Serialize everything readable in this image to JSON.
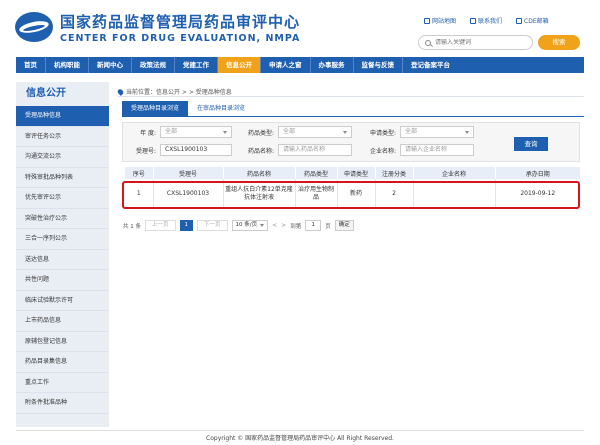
{
  "header": {
    "title_cn": "国家药品监督管理局药品审评中心",
    "title_en": "CENTER FOR DRUG EVALUATION, NMPA",
    "links": [
      "网站地图",
      "联系我们",
      "CDE邮箱"
    ],
    "search_placeholder": "请输入关键词",
    "search_button": "搜索"
  },
  "nav": {
    "items": [
      "首页",
      "机构职能",
      "新闻中心",
      "政策法规",
      "党建工作",
      "信息公开",
      "申请人之窗",
      "办事服务",
      "监督与反馈",
      "登记备案平台"
    ],
    "active": "信息公开"
  },
  "sidebar": {
    "title": "信息公开",
    "items": [
      "受理品种信息",
      "审评任务公示",
      "沟通交流公示",
      "特殊审批品种列表",
      "优先审评公示",
      "突破性治疗公示",
      "三合一序列公示",
      "送达信息",
      "共性问题",
      "临床试验默示许可",
      "上市药品信息",
      "原辅包登记信息",
      "药品目录集信息",
      "重点工作",
      "附条件批准品种"
    ],
    "active": "受理品种信息"
  },
  "breadcrumb": {
    "text": "当前位置：信息公开 > > 受理品种信息"
  },
  "tabs": [
    "受理品种目录浏览",
    "在审品种目录浏览"
  ],
  "filter": {
    "year_label": "年    度:",
    "year_value": "全部",
    "drug_type_label": "药品类型:",
    "drug_type_value": "全部",
    "apply_type_label": "申请类型:",
    "apply_type_value": "全部",
    "accept_no_label": "受理号:",
    "accept_no_value": "CXSL1900103",
    "drug_name_label": "药品名称:",
    "drug_name_placeholder": "请输入药品名称",
    "company_label": "企业名称:",
    "company_placeholder": "请输入企业名称",
    "query_button": "查询"
  },
  "table": {
    "headers": [
      "序号",
      "受理号",
      "药品名称",
      "药品类型",
      "申请类型",
      "注册分类",
      "企业名称",
      "承办日期"
    ],
    "row": {
      "index": "1",
      "accept_no": "CXSL1900103",
      "drug_name": "重组人抗白介素12单克隆抗体注射液",
      "drug_type": "治疗用生物制品",
      "apply_type": "新药",
      "reg_class": "2",
      "company": "",
      "date": "2019-09-12"
    }
  },
  "pager": {
    "total": "共 1 条",
    "prev": "上一页",
    "current": "1",
    "next": "下一页",
    "page_size": "10 条/页",
    "goto_label": "到第",
    "goto_value": "1",
    "page_unit": "页",
    "go_button": "确定"
  },
  "footer": {
    "copyright": "Copyright © 国家药品监督管理局药品审评中心  All Right Reserved."
  },
  "colors": {
    "primary": "#1f5fb0",
    "accent": "#f0a21a",
    "highlight": "#d6141c"
  }
}
